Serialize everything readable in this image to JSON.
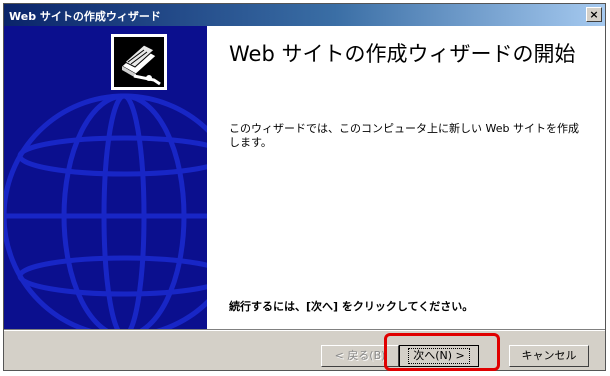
{
  "window": {
    "title": "Web サイトの作成ウィザード",
    "close_label": "×"
  },
  "sidebar": {
    "illustration": "globe-wizard",
    "icon": "book-wizard-icon",
    "background": "#0b0f8e"
  },
  "content": {
    "heading": "Web サイトの作成ウィザードの開始",
    "description": "このウィザードでは、このコンピュータ上に新しい Web サイトを作成します。",
    "continue_note": "続行するには、[次へ] をクリックしてください。"
  },
  "buttons": {
    "back": "< 戻る(B)",
    "next": "次へ(N) >",
    "cancel": "キャンセル"
  },
  "colors": {
    "highlight": "#e00000",
    "titlebar_start": "#0a246a",
    "titlebar_end": "#a6caf0"
  }
}
